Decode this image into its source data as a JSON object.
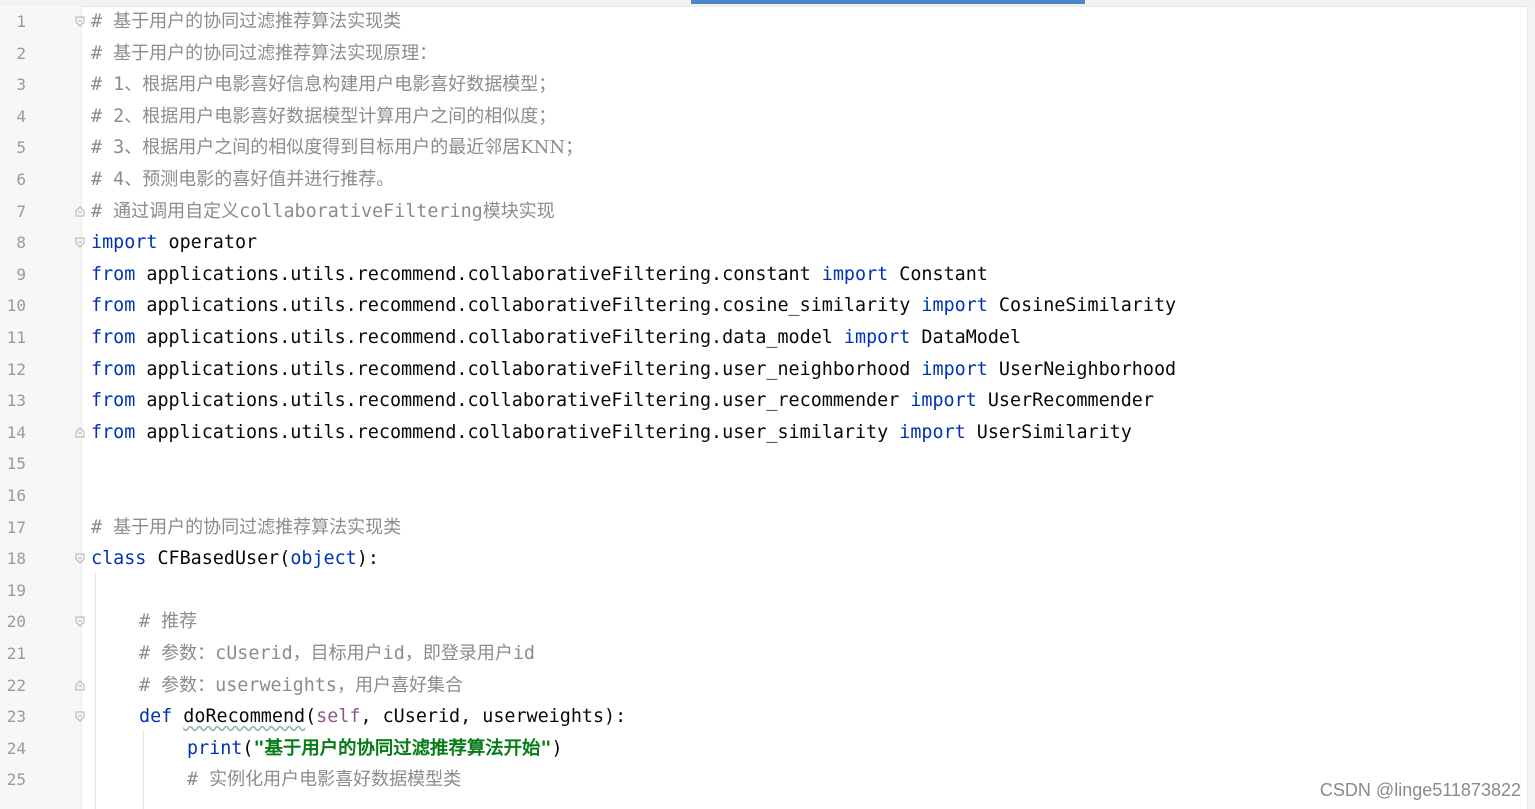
{
  "editor": {
    "lines": [
      {
        "n": "1",
        "c": [
          "# ",
          "基于用户的协同过滤推荐算法实现类"
        ]
      },
      {
        "n": "2",
        "c": [
          "# ",
          "基于用户的协同过滤推荐算法实现原理："
        ]
      },
      {
        "n": "3",
        "c": [
          "# 1",
          "、根据用户电影喜好信息构建用户电影喜好数据模型；"
        ]
      },
      {
        "n": "4",
        "c": [
          "# 2",
          "、根据用户电影喜好数据模型计算用户之间的相似度；"
        ]
      },
      {
        "n": "5",
        "c": [
          "# 3",
          "、根据用户之间的相似度得到目标用户的最近邻居",
          "KNN",
          "；"
        ]
      },
      {
        "n": "6",
        "c": [
          "# 4",
          "、预测电影的喜好值并进行推荐。"
        ]
      },
      {
        "n": "7",
        "c": [
          "# ",
          "通过调用自定义",
          "collaborativeFiltering",
          "模块实现"
        ]
      },
      {
        "n": "8",
        "kw": "import",
        "rest": " operator"
      },
      {
        "n": "9",
        "kw": "from",
        "mod": " applications.utils.recommend.collaborativeFiltering.constant ",
        "kw2": "import",
        "name": " Constant"
      },
      {
        "n": "10",
        "kw": "from",
        "mod": " applications.utils.recommend.collaborativeFiltering.cosine_similarity ",
        "kw2": "import",
        "name": " CosineSimilarity"
      },
      {
        "n": "11",
        "kw": "from",
        "mod": " applications.utils.recommend.collaborativeFiltering.data_model ",
        "kw2": "import",
        "name": " DataModel"
      },
      {
        "n": "12",
        "kw": "from",
        "mod": " applications.utils.recommend.collaborativeFiltering.user_neighborhood ",
        "kw2": "import",
        "name": " UserNeighborhood"
      },
      {
        "n": "13",
        "kw": "from",
        "mod": " applications.utils.recommend.collaborativeFiltering.user_recommender ",
        "kw2": "import",
        "name": " UserRecommender"
      },
      {
        "n": "14",
        "kw": "from",
        "mod": " applications.utils.recommend.collaborativeFiltering.user_similarity ",
        "kw2": "import",
        "name": " UserSimilarity"
      },
      {
        "n": "15"
      },
      {
        "n": "16"
      },
      {
        "n": "17",
        "c": [
          "# ",
          "基于用户的协同过滤推荐算法实现类"
        ]
      },
      {
        "n": "18",
        "kw": "class",
        "name": " CFBasedUser(",
        "builtin": "object",
        "tail": "):"
      },
      {
        "n": "19"
      },
      {
        "n": "20",
        "c": [
          "# ",
          "推荐"
        ]
      },
      {
        "n": "21",
        "c": [
          "# ",
          "参数：",
          "cUserid",
          "，目标用户",
          "id",
          "，即登录用户",
          "id"
        ]
      },
      {
        "n": "22",
        "c": [
          "# ",
          "参数：",
          "userweights",
          "，用户喜好集合"
        ]
      },
      {
        "n": "23",
        "kw": "def",
        "fn": "doRecommend",
        "open": "(",
        "self": "self",
        "params": ", cUserid, userweights):"
      },
      {
        "n": "24",
        "print": "print",
        "p1": "(",
        "str_open": "\"",
        "str_text": "基于用户的协同过滤推荐算法开始",
        "str_close": "\"",
        "p2": ")"
      },
      {
        "n": "25",
        "c": [
          "# ",
          "实例化用户电影喜好数据模型类"
        ]
      }
    ]
  },
  "watermark": "CSDN @linge511873822"
}
